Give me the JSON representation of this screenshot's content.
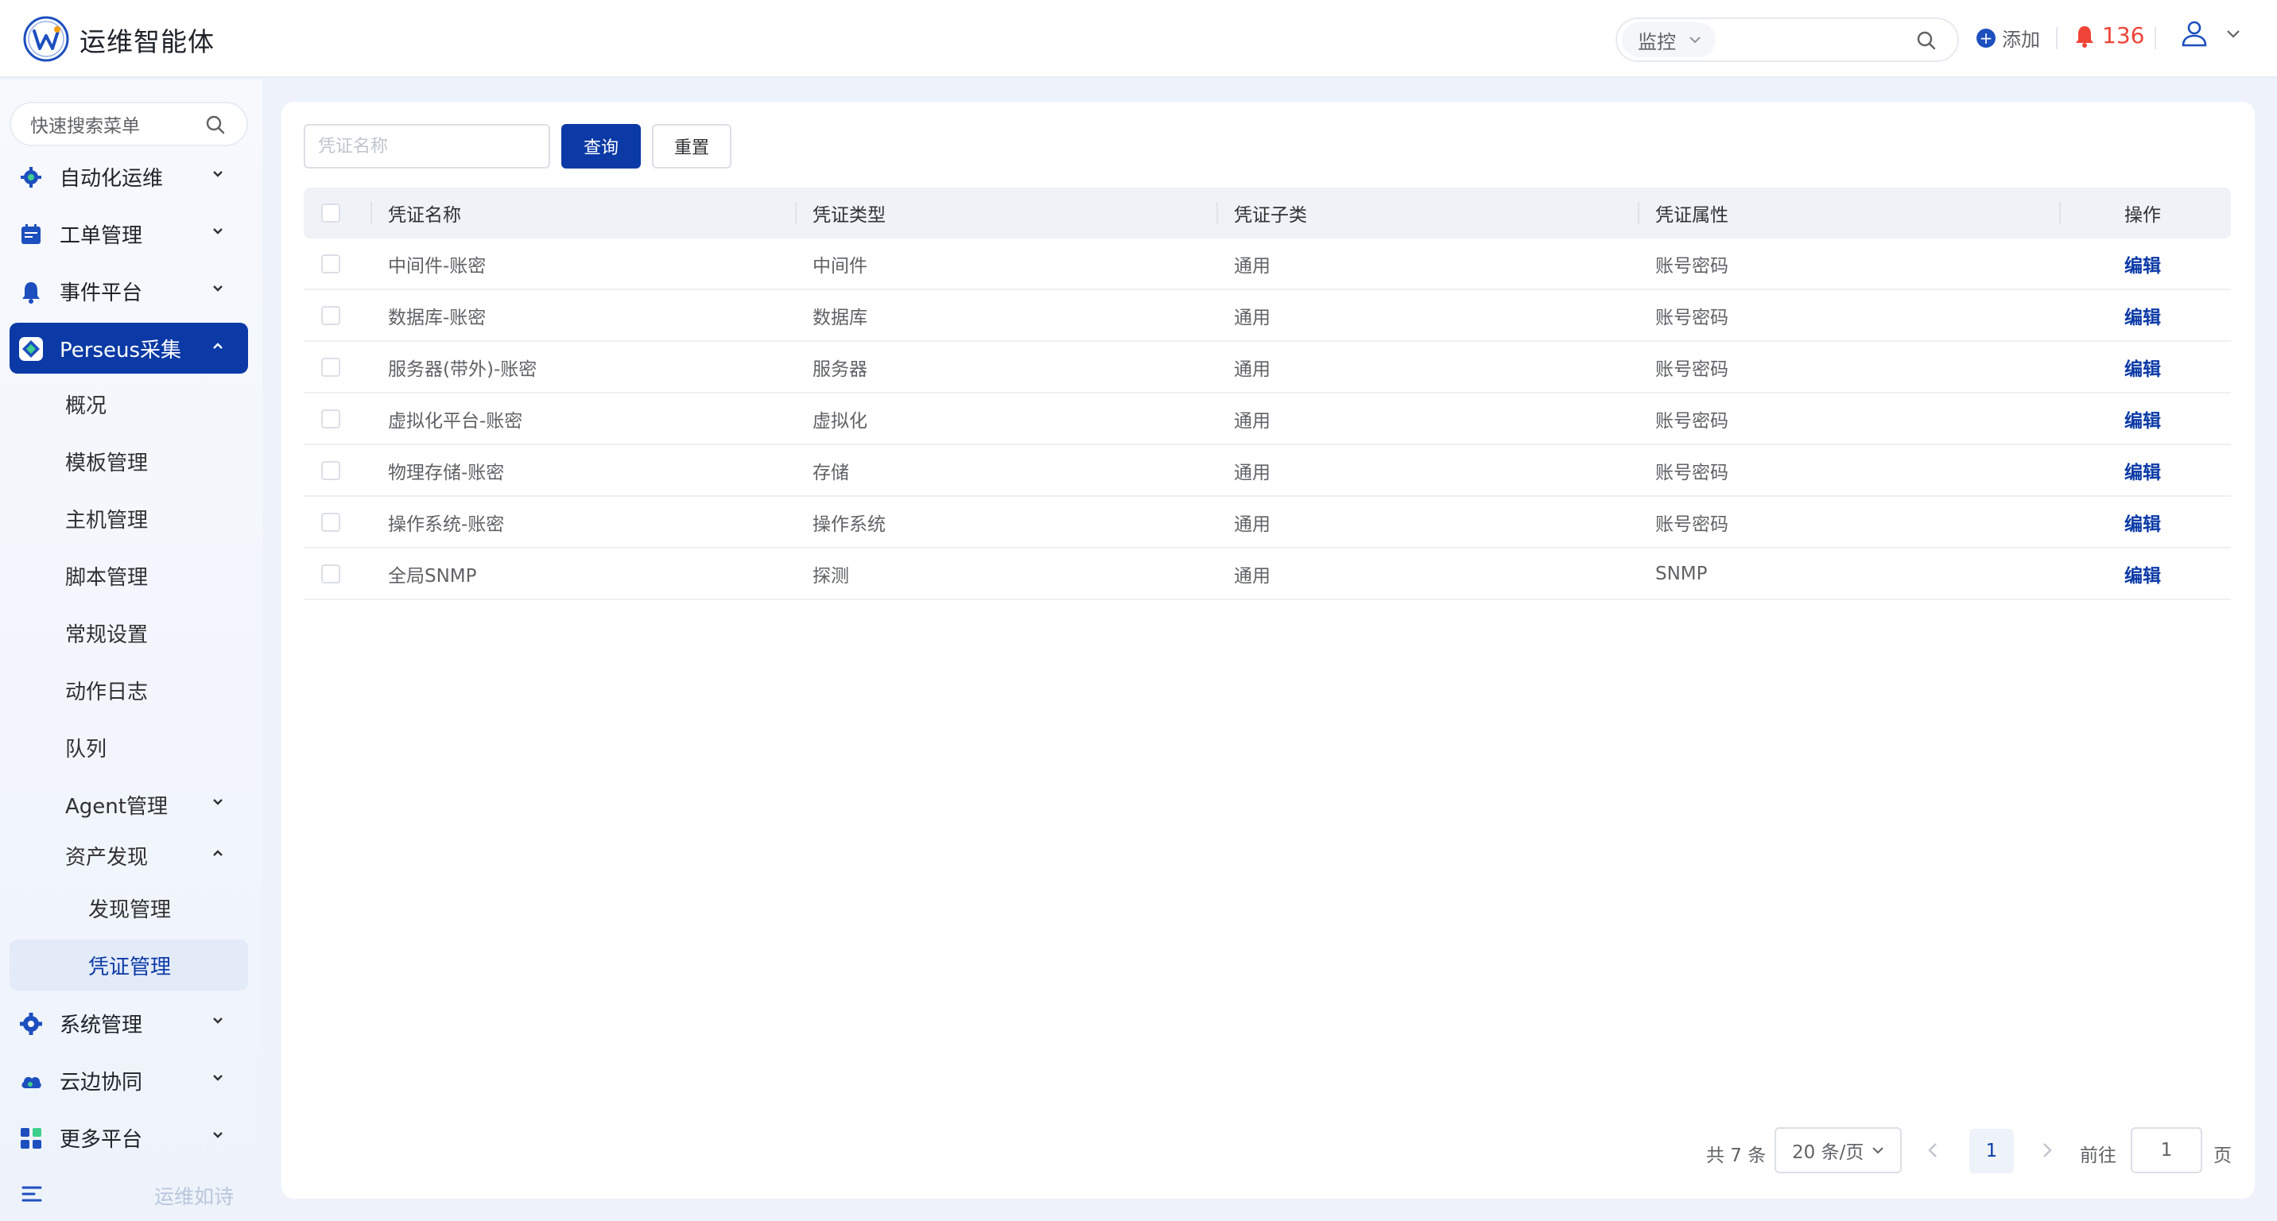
{
  "header": {
    "app_title": "运维智能体",
    "search_select_value": "监控",
    "add_label": "添加",
    "alert_count": "136"
  },
  "sidebar": {
    "search_placeholder": "快速搜索菜单",
    "items": [
      {
        "label": "自动化运维"
      },
      {
        "label": "工单管理"
      },
      {
        "label": "事件平台"
      },
      {
        "label": "Perseus采集"
      },
      {
        "label": "概况"
      },
      {
        "label": "模板管理"
      },
      {
        "label": "主机管理"
      },
      {
        "label": "脚本管理"
      },
      {
        "label": "常规设置"
      },
      {
        "label": "动作日志"
      },
      {
        "label": "队列"
      },
      {
        "label": "Agent管理"
      },
      {
        "label": "资产发现"
      },
      {
        "label": "发现管理"
      },
      {
        "label": "凭证管理"
      },
      {
        "label": "系统管理"
      },
      {
        "label": "云边协同"
      },
      {
        "label": "更多平台"
      }
    ],
    "footer_text": "运维如诗"
  },
  "filter": {
    "name_placeholder": "凭证名称",
    "query_label": "查询",
    "reset_label": "重置"
  },
  "table": {
    "columns": [
      "凭证名称",
      "凭证类型",
      "凭证子类",
      "凭证属性",
      "操作"
    ],
    "rows": [
      {
        "name": "中间件-账密",
        "type": "中间件",
        "subtype": "通用",
        "attr": "账号密码",
        "action": "编辑"
      },
      {
        "name": "数据库-账密",
        "type": "数据库",
        "subtype": "通用",
        "attr": "账号密码",
        "action": "编辑"
      },
      {
        "name": "服务器(带外)-账密",
        "type": "服务器",
        "subtype": "通用",
        "attr": "账号密码",
        "action": "编辑"
      },
      {
        "name": "虚拟化平台-账密",
        "type": "虚拟化",
        "subtype": "通用",
        "attr": "账号密码",
        "action": "编辑"
      },
      {
        "name": "物理存储-账密",
        "type": "存储",
        "subtype": "通用",
        "attr": "账号密码",
        "action": "编辑"
      },
      {
        "name": "操作系统-账密",
        "type": "操作系统",
        "subtype": "通用",
        "attr": "账号密码",
        "action": "编辑"
      },
      {
        "name": "全局SNMP",
        "type": "探测",
        "subtype": "通用",
        "attr": "SNMP",
        "action": "编辑"
      }
    ]
  },
  "pagination": {
    "total_text": "共 7 条",
    "page_size": "20 条/页",
    "current_page": "1",
    "goto_label": "前往",
    "jump_value": "1",
    "page_suffix": "页"
  },
  "colors": {
    "primary": "#0b3aa6",
    "alert": "#f04438"
  }
}
